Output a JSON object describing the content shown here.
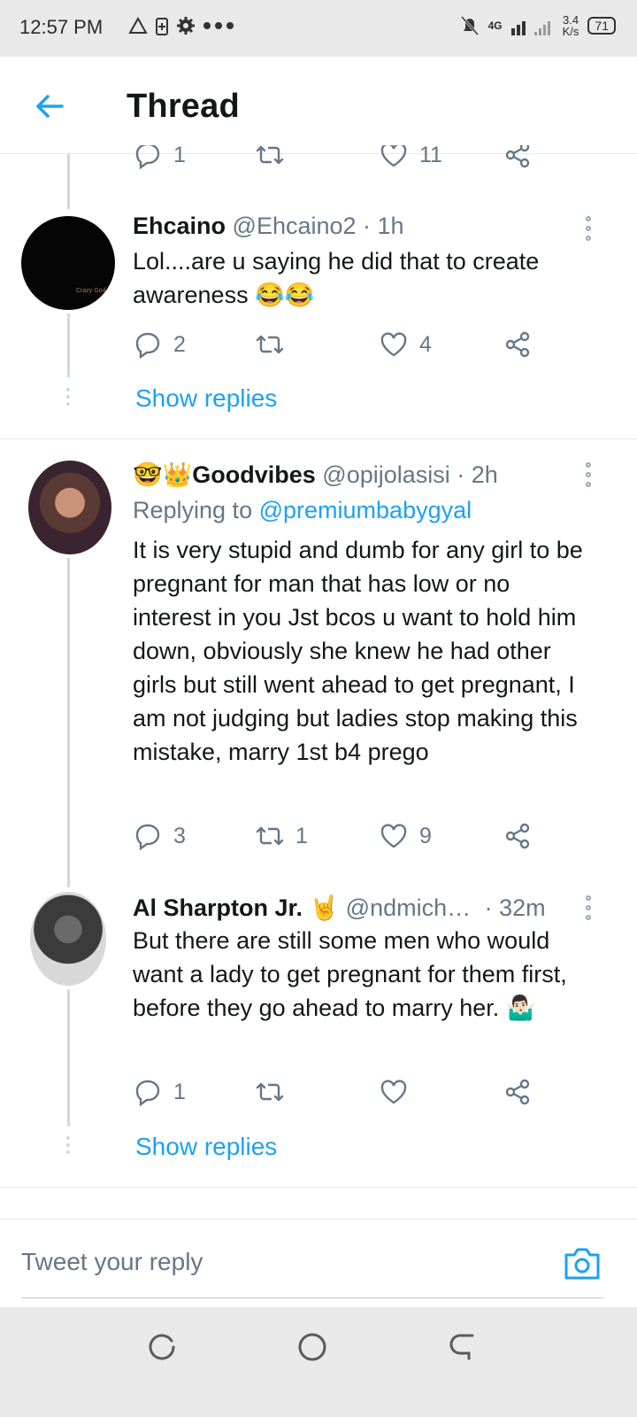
{
  "status_bar": {
    "time": "12:57 PM",
    "network": "4G",
    "speed_top": "3.4",
    "speed_bottom": "K/s",
    "battery": "71"
  },
  "header": {
    "title": "Thread"
  },
  "top_actions": {
    "reply_count": "1",
    "like_count": "11"
  },
  "tweets": [
    {
      "name": "Ehcaino",
      "handle": "@Ehcaino2 · 1h",
      "text": "Lol....are u saying he did that to create awareness 😂😂",
      "reply_count": "2",
      "retweet_count": "",
      "like_count": "4",
      "avatar_text": "Crazy God"
    },
    {
      "name": "🤓👑Goodvibes",
      "handle": "@opijolasisi · 2h",
      "replying_prefix": "Replying to",
      "replying_to": "@premiumbabygyal",
      "text": "It is very stupid and dumb for any girl to be pregnant for man that has low or no interest in you Jst bcos u want to hold him down, obviously she knew he had other girls but still went ahead to get pregnant, I am not judging but ladies stop making this mistake, marry 1st b4 prego",
      "reply_count": "3",
      "retweet_count": "1",
      "like_count": "9"
    },
    {
      "name": "Al Sharpton Jr. 🤘",
      "handle": "@ndmich…",
      "time": "· 32m",
      "text": "But there are still some men who would want a lady to get pregnant for them first, before they go ahead to marry her. 🤷🏻‍♂️",
      "reply_count": "1",
      "retweet_count": "",
      "like_count": ""
    }
  ],
  "show_replies": "Show replies",
  "reply_bar": {
    "placeholder": "Tweet your reply"
  },
  "colors": {
    "accent": "#1da1f2",
    "muted": "#657786",
    "thread_line": "#cfd9de"
  }
}
